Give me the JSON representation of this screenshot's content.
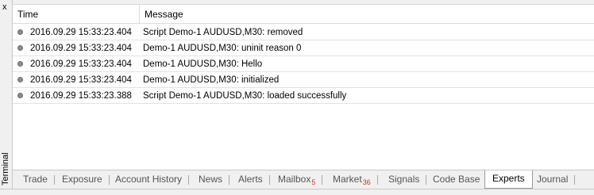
{
  "panel": {
    "side_label": "Terminal",
    "close_glyph": "x"
  },
  "columns": {
    "time": "Time",
    "message": "Message"
  },
  "rows": [
    {
      "time": "2016.09.29 15:33:23.404",
      "message": "Script Demo-1 AUDUSD,M30: removed"
    },
    {
      "time": "2016.09.29 15:33:23.404",
      "message": "Demo-1 AUDUSD,M30: uninit reason 0"
    },
    {
      "time": "2016.09.29 15:33:23.404",
      "message": "Demo-1 AUDUSD,M30: Hello"
    },
    {
      "time": "2016.09.29 15:33:23.404",
      "message": "Demo-1 AUDUSD,M30: initialized"
    },
    {
      "time": "2016.09.29 15:33:23.388",
      "message": "Script Demo-1 AUDUSD,M30: loaded successfully"
    }
  ],
  "tabs": [
    {
      "label": "Trade"
    },
    {
      "label": "Exposure"
    },
    {
      "label": "Account History"
    },
    {
      "label": "News"
    },
    {
      "label": "Alerts"
    },
    {
      "label": "Mailbox",
      "badge": "5"
    },
    {
      "label": "Market",
      "badge": "36"
    },
    {
      "label": "Signals"
    },
    {
      "label": "Code Base"
    },
    {
      "label": "Experts",
      "active": true
    },
    {
      "label": "Journal"
    }
  ],
  "colors": {
    "badge": "#c0392b",
    "row_icon": "#8c8c8c"
  }
}
